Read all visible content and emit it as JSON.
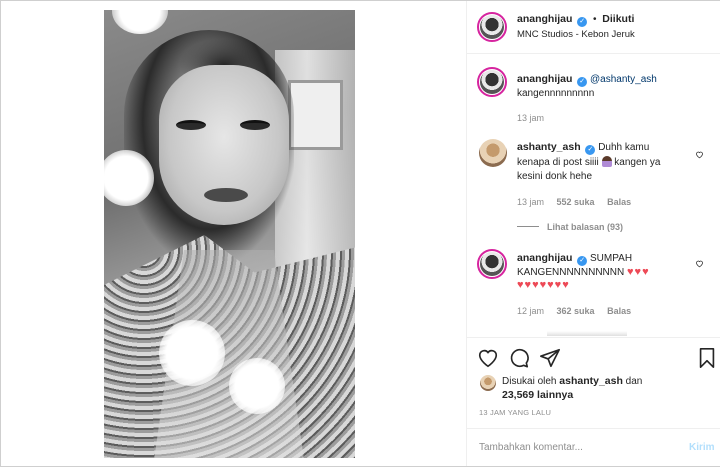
{
  "header": {
    "username": "ananghijau",
    "separator": "•",
    "follow_state": "Diikuti",
    "location": "MNC Studios - Kebon Jeruk"
  },
  "caption": {
    "username": "ananghijau",
    "mention": "@ashanty_ash",
    "text": "kangennnnnnnnn",
    "time": "13 jam"
  },
  "comments": [
    {
      "username": "ashanty_ash",
      "text_line1": "Duhh kamu",
      "text_line2": "kenapa di post siiii",
      "text_line2b": "kangen ya",
      "text_line3": "kesini donk hehe",
      "time": "13 jam",
      "likes": "552 suka",
      "reply": "Balas",
      "view_replies": "Lihat balasan (93)"
    },
    {
      "username": "ananghijau",
      "text_line1": "SUMPAH",
      "text_line2": "KANGENNNNNNNNNN",
      "hearts_line2": "♥♥♥",
      "hearts_line3": "♥♥♥♥♥♥♥",
      "time": "12 jam",
      "likes": "362 suka",
      "reply": "Balas"
    }
  ],
  "likes": {
    "prefix": "Disukai oleh",
    "user": "ashanty_ash",
    "conj": "dan",
    "count": "23,569 lainnya"
  },
  "timestamp": "13 JAM YANG LALU",
  "comment_input": {
    "placeholder": "Tambahkan komentar...",
    "submit": "Kirim"
  },
  "colors": {
    "verified": "#3897f0",
    "heart": "#ed4956",
    "link": "#00376b",
    "muted": "#8e8e8e"
  }
}
